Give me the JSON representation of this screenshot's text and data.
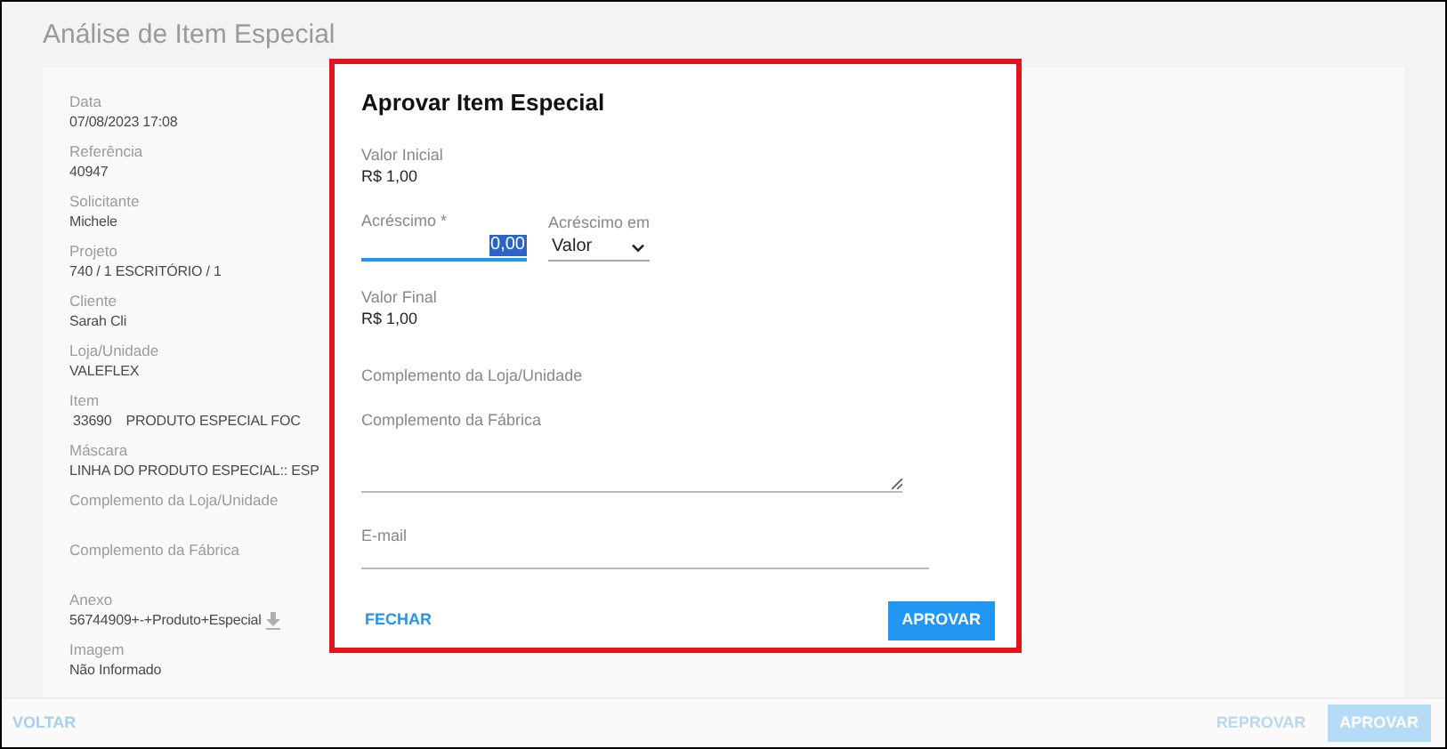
{
  "page": {
    "title": "Análise de Item Especial"
  },
  "details": [
    {
      "label": "Data",
      "value": "07/08/2023 17:08"
    },
    {
      "label": "Referência",
      "value": "40947"
    },
    {
      "label": "Solicitante",
      "value": "Michele"
    },
    {
      "label": "Projeto",
      "value": "740 / 1 ESCRITÓRIO / 1"
    },
    {
      "label": "Cliente",
      "value": "Sarah Cli"
    },
    {
      "label": "Loja/Unidade",
      "value": "VALEFLEX"
    },
    {
      "label": "Item",
      "value": "33690",
      "value_2": "PRODUTO ESPECIAL FOC"
    },
    {
      "label": "Máscara",
      "value": "LINHA DO PRODUTO ESPECIAL:: ESP"
    },
    {
      "label": "Complemento da Loja/Unidade"
    },
    {
      "label": "Complemento da Fábrica"
    },
    {
      "label": "Anexo",
      "value": "56744909+-+Produto+Especial",
      "download": true
    },
    {
      "label": "Imagem",
      "value": "Não Informado"
    }
  ],
  "footer": {
    "back": "VOLTAR",
    "reject": "REPROVAR",
    "approve": "APROVAR"
  },
  "dialog": {
    "title": "Aprovar Item Especial",
    "initial": {
      "label": "Valor Inicial",
      "value": "R$ 1,00"
    },
    "increase": {
      "label": "Acréscimo *",
      "value": "0,00"
    },
    "increase_type": {
      "label": "Acréscimo em",
      "value": "Valor"
    },
    "final": {
      "label": "Valor Final",
      "value": "R$ 1,00"
    },
    "store_note": {
      "label": "Complemento da Loja/Unidade"
    },
    "factory_note": {
      "label": "Complemento da Fábrica"
    },
    "email": {
      "label": "E-mail"
    },
    "close": "FECHAR",
    "approve": "APROVAR"
  }
}
